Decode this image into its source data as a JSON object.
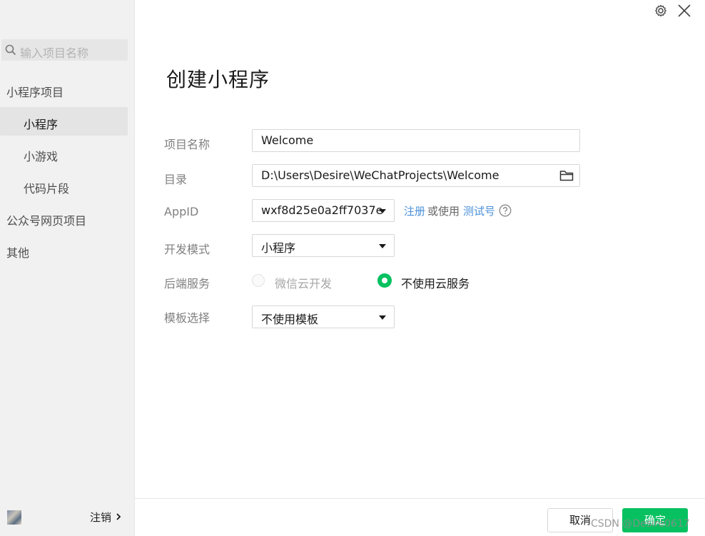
{
  "sidebar": {
    "search_placeholder": "输入项目名称",
    "items": [
      {
        "label": "小程序项目"
      },
      {
        "label": "小程序"
      },
      {
        "label": "小游戏"
      },
      {
        "label": "代码片段"
      },
      {
        "label": "公众号网页项目"
      },
      {
        "label": "其他"
      }
    ],
    "selected": "小程序",
    "logout_label": "注销"
  },
  "main": {
    "title": "创建小程序",
    "fields": {
      "project_name": {
        "label": "项目名称",
        "value": "Welcome"
      },
      "directory": {
        "label": "目录",
        "value": "D:\\Users\\Desire\\WeChatProjects\\Welcome"
      },
      "appid": {
        "label": "AppID",
        "value": "wxf8d25e0a2ff7037e",
        "register_link": "注册",
        "or_use": "或使用",
        "test_link": "测试号"
      },
      "dev_mode": {
        "label": "开发模式",
        "value": "小程序"
      },
      "backend": {
        "label": "后端服务",
        "options": [
          {
            "label": "微信云开发",
            "selected": false,
            "disabled": true
          },
          {
            "label": "不使用云服务",
            "selected": true,
            "disabled": false
          }
        ]
      },
      "template": {
        "label": "模板选择",
        "value": "不使用模板"
      }
    }
  },
  "footer": {
    "cancel_label": "取消",
    "confirm_label": "确定"
  },
  "watermark": "CSDN @Desire0617",
  "colors": {
    "accent": "#07c160",
    "link": "#4a90d9",
    "sidebar_bg": "#f1f1f1"
  },
  "icons": [
    "search-icon",
    "gear-icon",
    "close-icon",
    "folder-icon",
    "help-icon",
    "chevron-right-icon",
    "dropdown-arrow-icon"
  ]
}
